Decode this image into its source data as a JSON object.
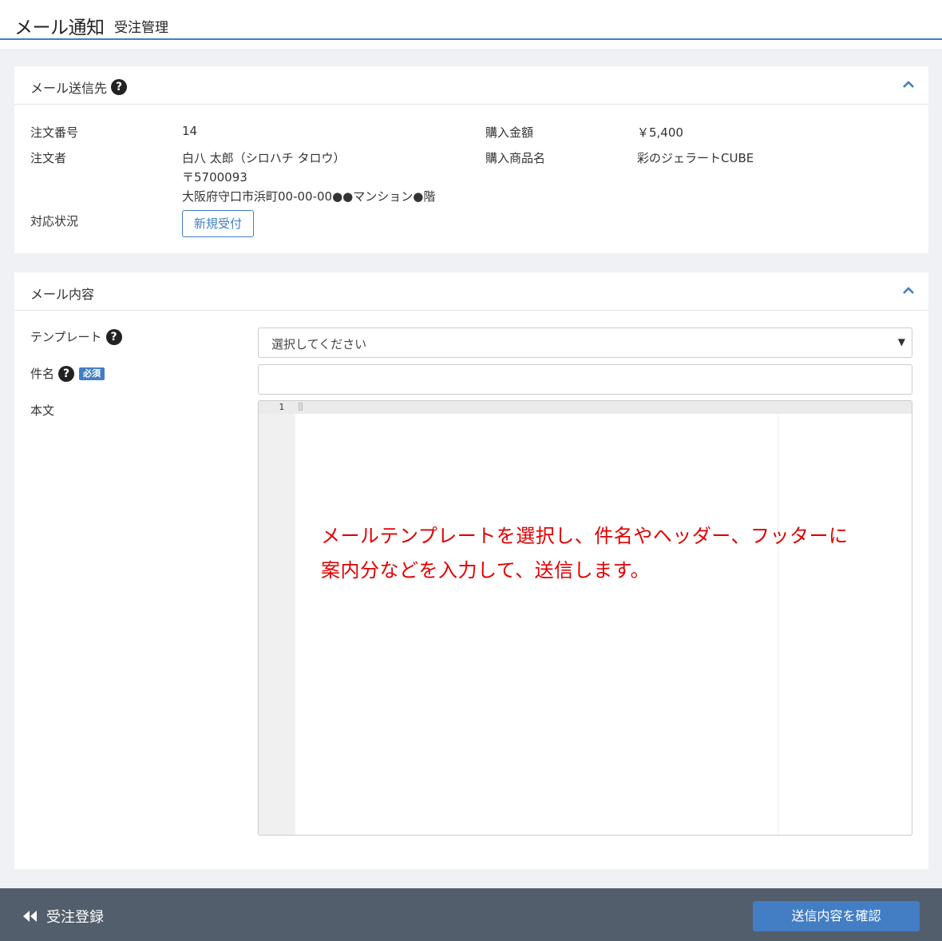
{
  "header": {
    "title": "メール通知",
    "subtitle": "受注管理"
  },
  "recipient_card": {
    "title": "メール送信先",
    "fields": {
      "order_no_label": "注文番号",
      "order_no": "14",
      "amount_label": "購入金額",
      "amount": "￥5,400",
      "customer_label": "注文者",
      "customer_name": "白八 太郎（シロハチ タロウ）",
      "postal": "〒5700093",
      "address": "大阪府守口市浜町00-00-00●●マンション●階",
      "product_label": "購入商品名",
      "product": "彩のジェラートCUBE",
      "status_label": "対応状況",
      "status": "新規受付"
    }
  },
  "content_card": {
    "title": "メール内容",
    "template_label": "テンプレート",
    "template_selected": "選択してください",
    "subject_label": "件名",
    "required_badge": "必須",
    "subject_value": "",
    "body_label": "本文",
    "editor_line_number": "1"
  },
  "annotation": {
    "line1": "メールテンプレートを選択し、件名やヘッダー、フッターに",
    "line2": "案内分などを入力して、送信します。"
  },
  "footer": {
    "back_label": "受注登録",
    "confirm_label": "送信内容を確認"
  },
  "colors": {
    "accent": "#437ec4",
    "footer_bg": "#535e6c",
    "annotation": "#e00000",
    "page_bg": "#f0f1f4"
  }
}
